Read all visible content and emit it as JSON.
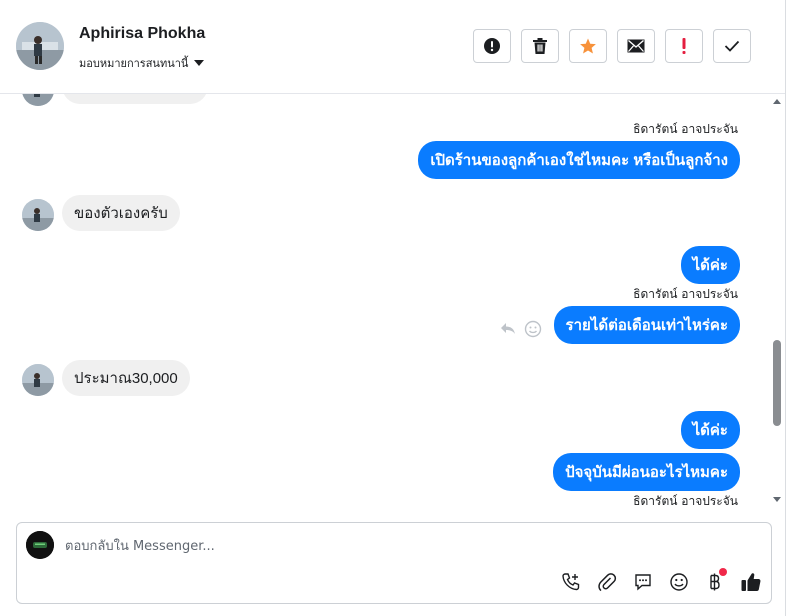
{
  "header": {
    "contact_name": "Aphirisa Phokha",
    "assign_label": "มอบหมายการสนทนานี้",
    "actions": [
      {
        "name": "spam-button",
        "icon": "exclamation-circle-icon"
      },
      {
        "name": "delete-button",
        "icon": "trash-icon"
      },
      {
        "name": "star-button",
        "icon": "star-icon"
      },
      {
        "name": "mark-unread-button",
        "icon": "envelope-icon"
      },
      {
        "name": "follow-up-button",
        "icon": "exclamation-icon"
      },
      {
        "name": "mark-done-button",
        "icon": "checkmark-icon"
      }
    ]
  },
  "thread": {
    "messages": [
      {
        "sender": "ธิดารัตน์ อาจประจัน",
        "text": "เปิดร้านของลูกค้าเองใช่ไหมคะ หรือเป็นลูกจ้าง",
        "direction": "out"
      },
      {
        "text": "ของตัวเองครับ",
        "direction": "in"
      },
      {
        "text": "ได้ค่ะ",
        "direction": "out"
      },
      {
        "sender": "ธิดารัตน์ อาจประจัน",
        "text": "รายได้ต่อเดือนเท่าไหร่คะ",
        "direction": "out"
      },
      {
        "text": "ประมาณ30,000",
        "direction": "in"
      },
      {
        "text": "ได้ค่ะ",
        "direction": "out"
      },
      {
        "text": "ปัจจุบันมีผ่อนอะไรไหมคะ",
        "direction": "out"
      },
      {
        "sender": "ธิดารัตน์ อาจประจัน",
        "direction": "out"
      }
    ]
  },
  "composer": {
    "placeholder": "ตอบกลับใน Messenger...",
    "tools": [
      "phone-plus-icon",
      "paperclip-icon",
      "chat-bubble-icon",
      "smiley-icon",
      "baht-icon",
      "thumbs-up-icon"
    ]
  },
  "colors": {
    "accent": "#0a7cff",
    "star": "#f7923b",
    "alert": "#e41e3f",
    "incoming_bg": "#f0f0f0"
  }
}
